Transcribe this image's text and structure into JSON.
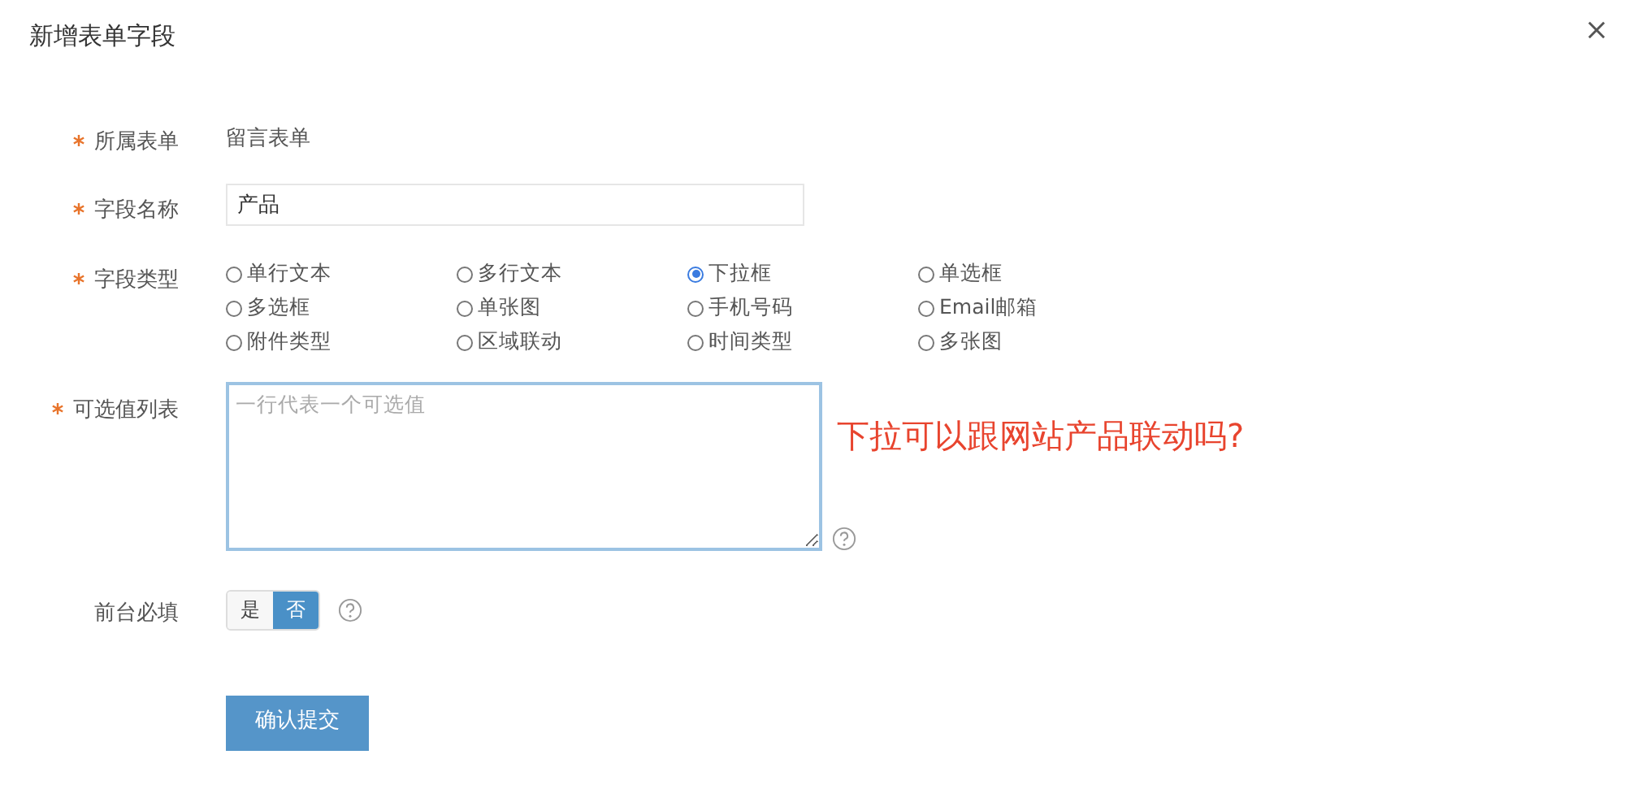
{
  "dialog": {
    "title": "新增表单字段"
  },
  "form": {
    "owner": {
      "label": "所属表单",
      "required": true,
      "value": "留言表单"
    },
    "name": {
      "label": "字段名称",
      "required": true,
      "value": "产品"
    },
    "type": {
      "label": "字段类型",
      "required": true,
      "options": [
        {
          "label": "单行文本",
          "selected": false
        },
        {
          "label": "多行文本",
          "selected": false
        },
        {
          "label": "下拉框",
          "selected": true
        },
        {
          "label": "单选框",
          "selected": false
        },
        {
          "label": "多选框",
          "selected": false
        },
        {
          "label": "单张图",
          "selected": false
        },
        {
          "label": "手机号码",
          "selected": false
        },
        {
          "label": "Email邮箱",
          "selected": false
        },
        {
          "label": "附件类型",
          "selected": false
        },
        {
          "label": "区域联动",
          "selected": false
        },
        {
          "label": "时间类型",
          "selected": false
        },
        {
          "label": "多张图",
          "selected": false
        }
      ]
    },
    "options_list": {
      "label": "可选值列表",
      "required": true,
      "placeholder": "一行代表一个可选值"
    },
    "mandatory": {
      "label": "前台必填",
      "choices": [
        {
          "label": "是",
          "selected": false
        },
        {
          "label": "否",
          "selected": true
        }
      ]
    },
    "submit": "确认提交"
  },
  "annotation": "下拉可以跟网站产品联动吗?"
}
